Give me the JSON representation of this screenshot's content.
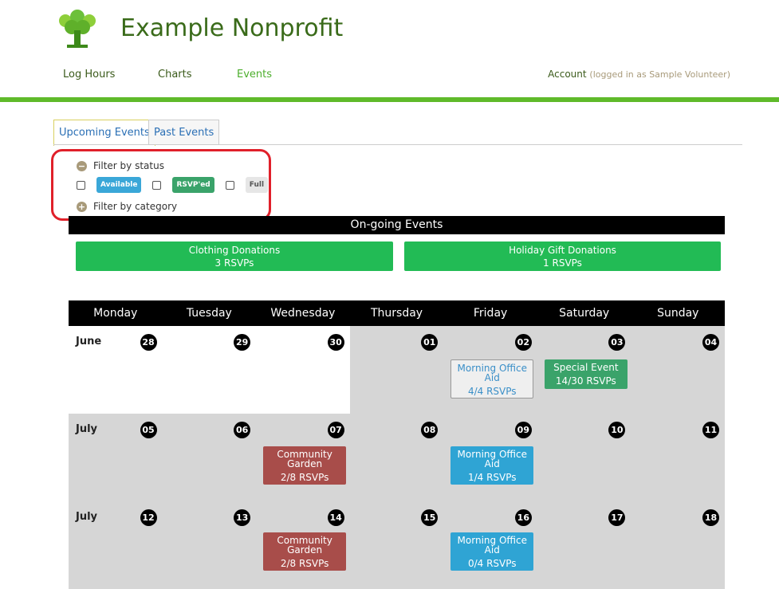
{
  "header": {
    "title": "Example Nonprofit",
    "nav": [
      "Log Hours",
      "Charts",
      "Events"
    ],
    "account_label": "Account",
    "logged_in_text": "(logged in as Sample Volunteer)"
  },
  "tabs": [
    "Upcoming Events",
    "Past Events"
  ],
  "filter": {
    "by_status": "Filter by status",
    "by_category": "Filter by category",
    "badges": [
      "Available",
      "RSVP'ed",
      "Full"
    ]
  },
  "ongoing": {
    "title": "On-going Events",
    "items": [
      {
        "name": "Clothing Donations",
        "rsvps": "3 RSVPs"
      },
      {
        "name": "Holiday Gift Donations",
        "rsvps": "1 RSVPs"
      }
    ]
  },
  "calendar": {
    "weekdays": [
      "Monday",
      "Tuesday",
      "Wednesday",
      "Thursday",
      "Friday",
      "Saturday",
      "Sunday"
    ],
    "weeks": [
      {
        "month": "June",
        "days": [
          "28",
          "29",
          "30",
          "01",
          "02",
          "03",
          "04"
        ]
      },
      {
        "month": "July",
        "days": [
          "05",
          "06",
          "07",
          "08",
          "09",
          "10",
          "11"
        ]
      },
      {
        "month": "July",
        "days": [
          "12",
          "13",
          "14",
          "15",
          "16",
          "17",
          "18"
        ]
      }
    ],
    "events": [
      {
        "name": "Morning Office Aid",
        "rsvps": "4/4 RSVPs"
      },
      {
        "name": "Special Event",
        "rsvps": "14/30 RSVPs"
      },
      {
        "name": "Community Garden",
        "rsvps": "2/8 RSVPs"
      },
      {
        "name": "Morning Office Aid",
        "rsvps": "1/4 RSVPs"
      },
      {
        "name": "Community Garden",
        "rsvps": "2/8 RSVPs"
      },
      {
        "name": "Morning Office Aid",
        "rsvps": "0/4 RSVPs"
      }
    ]
  }
}
